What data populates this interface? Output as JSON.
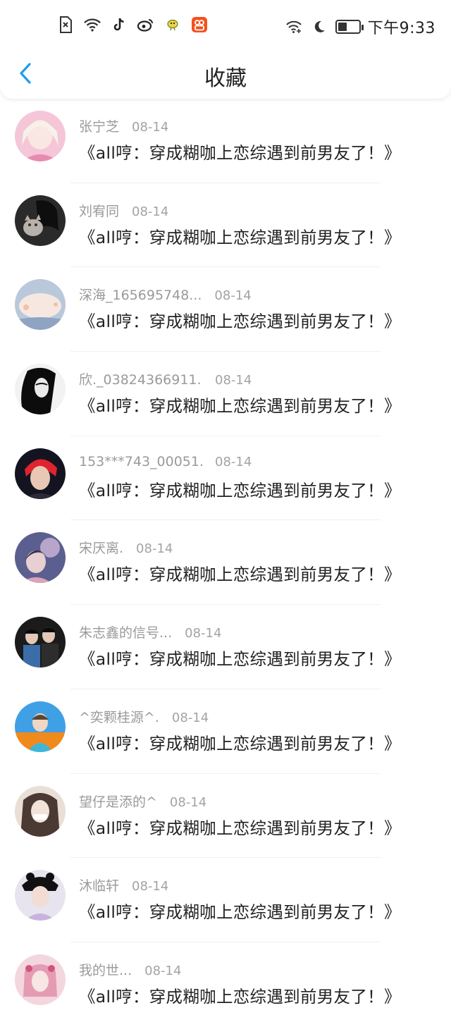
{
  "status_bar": {
    "time": "下午9:33",
    "left_icons": [
      "sim-x-icon",
      "wifi-icon",
      "tiktok-icon",
      "weibo-icon",
      "bird-app-icon",
      "orange-app-icon"
    ],
    "right_icons": [
      "wifi-plus-icon",
      "moon-icon",
      "battery-icon"
    ]
  },
  "nav": {
    "title": "收藏",
    "back_icon": "chevron-left-icon"
  },
  "colors": {
    "accent": "#1E9BF0",
    "meta_text": "#9a9a9a",
    "title_text": "#222222"
  },
  "items": [
    {
      "name": "张宁芝",
      "date": "08-14",
      "title": "《all哼：穿成糊咖上恋综遇到前男友了！》"
    },
    {
      "name": "刘宥同",
      "date": "08-14",
      "title": "《all哼：穿成糊咖上恋综遇到前男友了！》"
    },
    {
      "name": "深海_165695748...",
      "date": "08-14",
      "title": "《all哼：穿成糊咖上恋综遇到前男友了！》"
    },
    {
      "name": "欣._03824366911...",
      "date": "08-14",
      "title": "《all哼：穿成糊咖上恋综遇到前男友了！》"
    },
    {
      "name": "153***743_00051...",
      "date": "08-14",
      "title": "《all哼：穿成糊咖上恋综遇到前男友了！》"
    },
    {
      "name": "宋厌离.",
      "date": "08-14",
      "title": "《all哼：穿成糊咖上恋综遇到前男友了！》"
    },
    {
      "name": "朱志鑫的信号...",
      "date": "08-14",
      "title": "《all哼：穿成糊咖上恋综遇到前男友了！》"
    },
    {
      "name": "^奕颗桂源^.",
      "date": "08-14",
      "title": "《all哼：穿成糊咖上恋综遇到前男友了！》"
    },
    {
      "name": "望仔是添的^",
      "date": "08-14",
      "title": "《all哼：穿成糊咖上恋综遇到前男友了！》"
    },
    {
      "name": "沐临轩",
      "date": "08-14",
      "title": "《all哼：穿成糊咖上恋综遇到前男友了！》"
    },
    {
      "name": "我的世...",
      "date": "08-14",
      "title": "《all哼：穿成糊咖上恋综遇到前男友了！》"
    }
  ]
}
